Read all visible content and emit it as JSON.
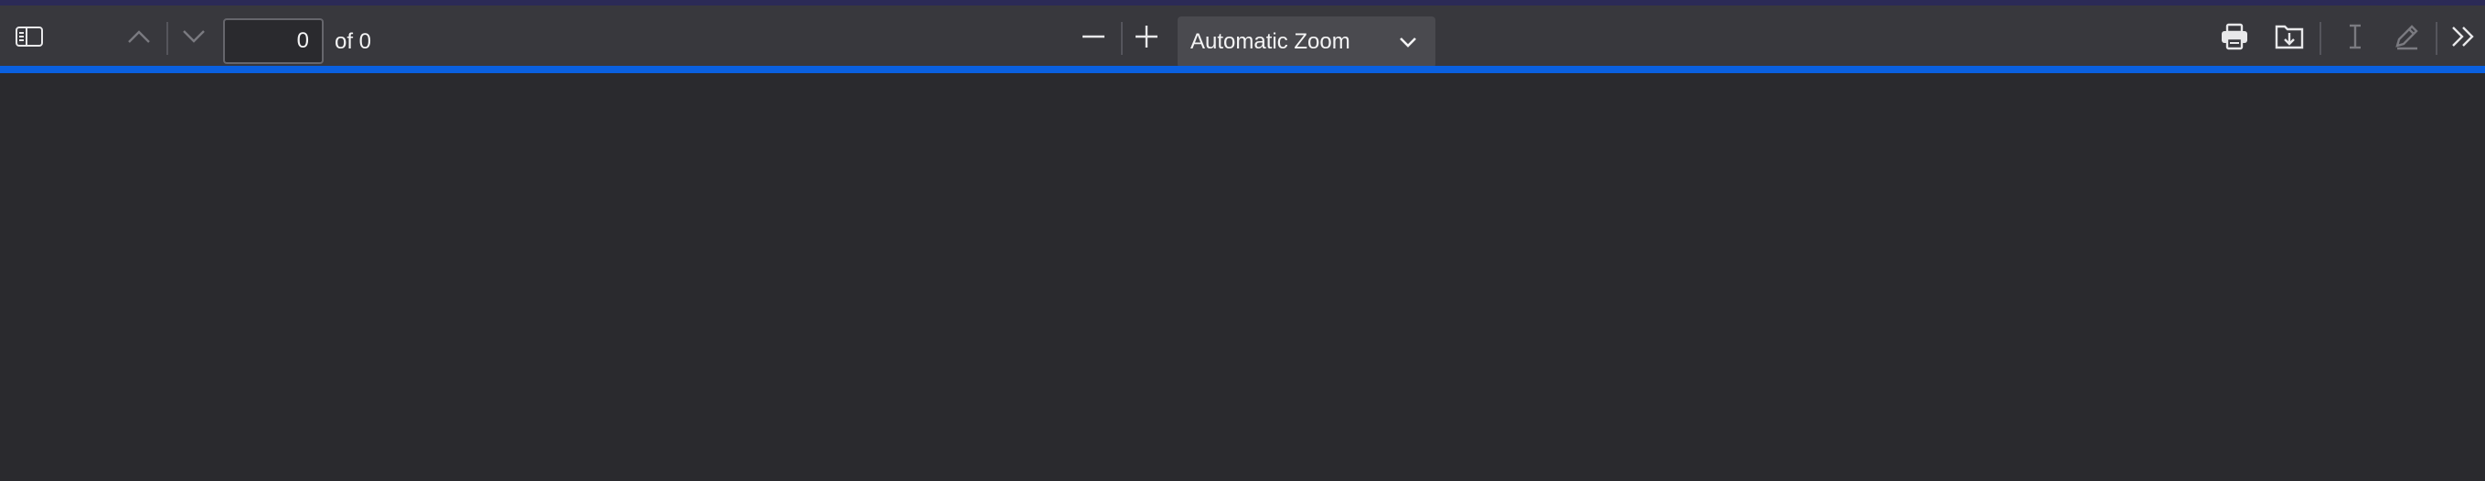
{
  "toolbar": {
    "page_number": "0",
    "page_count_label": "of 0",
    "zoom_selected": "Automatic Zoom"
  },
  "icons": {
    "sidebar_toggle": "sidebar-icon",
    "previous_page": "chevron-up-icon",
    "next_page": "chevron-down-icon",
    "zoom_out": "minus-icon",
    "zoom_in": "plus-icon",
    "zoom_dropdown": "chevron-down-icon",
    "print": "printer-icon",
    "save": "download-icon",
    "text_tool": "text-cursor-icon",
    "draw_tool": "pen-icon",
    "more_tools": "double-chevron-right-icon"
  },
  "colors": {
    "toolbar_bg": "#38383d",
    "viewer_bg": "#2a2a2e",
    "progress_accent": "#0a60e0",
    "top_strip": "#2b2a56"
  },
  "loading_progress": 1.0
}
